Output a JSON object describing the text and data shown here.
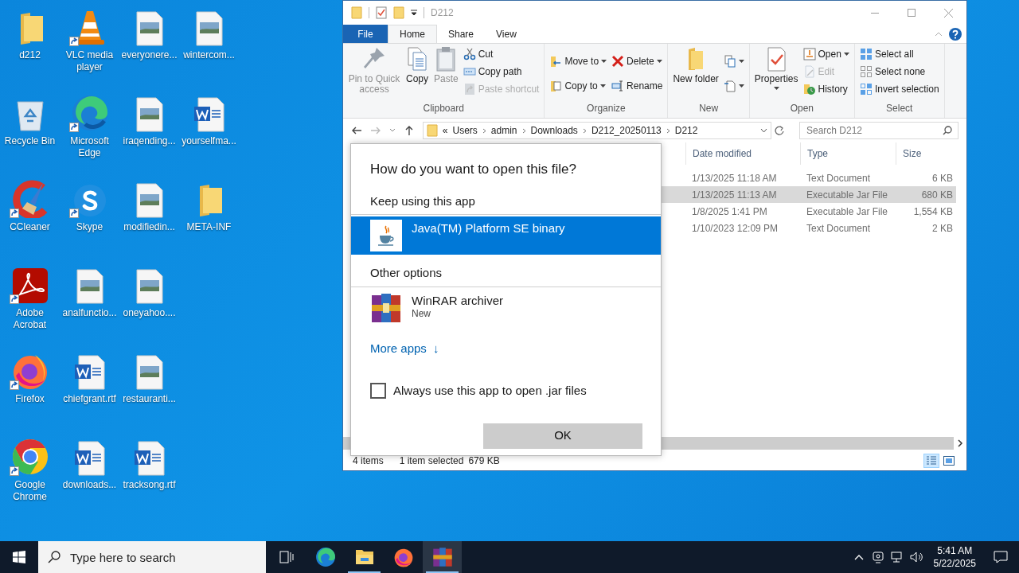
{
  "desktop": {
    "icons": [
      {
        "label": "d212",
        "kind": "folder",
        "shortcut": false
      },
      {
        "label": "Recycle Bin",
        "kind": "recycle",
        "shortcut": false
      },
      {
        "label": "CCleaner",
        "kind": "ccleaner",
        "shortcut": true
      },
      {
        "label": "Adobe Acrobat",
        "kind": "acrobat",
        "shortcut": true
      },
      {
        "label": "Firefox",
        "kind": "firefox",
        "shortcut": true
      },
      {
        "label": "Google Chrome",
        "kind": "chrome",
        "shortcut": true
      },
      {
        "label": "VLC media player",
        "kind": "vlc",
        "shortcut": true
      },
      {
        "label": "Microsoft Edge",
        "kind": "edge",
        "shortcut": true
      },
      {
        "label": "Skype",
        "kind": "skype",
        "shortcut": true
      },
      {
        "label": "analfunctio...",
        "kind": "image",
        "shortcut": false
      },
      {
        "label": "chiefgrant.rtf",
        "kind": "word",
        "shortcut": false
      },
      {
        "label": "downloads...",
        "kind": "word",
        "shortcut": false
      },
      {
        "label": "everyonere...",
        "kind": "image",
        "shortcut": false
      },
      {
        "label": "iraqending...",
        "kind": "image",
        "shortcut": false
      },
      {
        "label": "modifiedin...",
        "kind": "image",
        "shortcut": false
      },
      {
        "label": "oneyahoo....",
        "kind": "image",
        "shortcut": false
      },
      {
        "label": "restauranti...",
        "kind": "image",
        "shortcut": false
      },
      {
        "label": "tracksong.rtf",
        "kind": "word",
        "shortcut": false
      },
      {
        "label": "wintercom...",
        "kind": "image",
        "shortcut": false
      },
      {
        "label": "yourselfma...",
        "kind": "word",
        "shortcut": false
      },
      {
        "label": "META-INF",
        "kind": "folder",
        "shortcut": false
      }
    ]
  },
  "explorer": {
    "title": "D212",
    "file_tab": "File",
    "tabs": [
      {
        "label": "Home",
        "selected": true
      },
      {
        "label": "Share",
        "selected": false
      },
      {
        "label": "View",
        "selected": false
      }
    ],
    "ribbon": [
      {
        "label": "Clipboard",
        "columns": [
          {
            "kind": "large",
            "label": "Pin to Quick access",
            "disabled": true,
            "dropdown": false
          },
          {
            "kind": "large",
            "label": "Copy",
            "disabled": false,
            "dropdown": false
          },
          {
            "kind": "large",
            "label": "Paste",
            "disabled": true,
            "dropdown": false
          },
          {
            "kind": "stack",
            "items": [
              {
                "label": "Cut",
                "disabled": false,
                "dropdown": false
              },
              {
                "label": "Copy path",
                "disabled": false,
                "dropdown": false
              },
              {
                "label": "Paste shortcut",
                "disabled": true,
                "dropdown": false
              }
            ]
          }
        ]
      },
      {
        "label": "Organize",
        "columns": [
          {
            "kind": "stack",
            "items": [
              {
                "label": "Move to",
                "disabled": false,
                "dropdown": true
              },
              {
                "label": "Copy to",
                "disabled": false,
                "dropdown": true
              }
            ]
          },
          {
            "kind": "stack",
            "items": [
              {
                "label": "Delete",
                "disabled": false,
                "dropdown": true
              },
              {
                "label": "Rename",
                "disabled": false,
                "dropdown": false
              }
            ]
          }
        ]
      },
      {
        "label": "New",
        "columns": [
          {
            "kind": "large",
            "label": "New folder",
            "disabled": false,
            "dropdown": false
          },
          {
            "kind": "stack",
            "items": [
              {
                "disabled": false,
                "dropdown": true
              },
              {
                "disabled": false,
                "dropdown": true
              }
            ]
          }
        ]
      },
      {
        "label": "Open",
        "columns": [
          {
            "kind": "large",
            "label": "Properties",
            "disabled": false,
            "dropdown": true
          },
          {
            "kind": "stack",
            "items": [
              {
                "label": "Open",
                "disabled": false,
                "dropdown": true
              },
              {
                "label": "Edit",
                "disabled": true,
                "dropdown": false
              },
              {
                "label": "History",
                "disabled": false,
                "dropdown": false
              }
            ]
          }
        ]
      },
      {
        "label": "Select",
        "columns": [
          {
            "kind": "stack",
            "items": [
              {
                "label": "Select all",
                "disabled": false,
                "dropdown": false
              },
              {
                "label": "Select none",
                "disabled": false,
                "dropdown": false
              },
              {
                "label": "Invert selection",
                "disabled": false,
                "dropdown": false
              }
            ]
          }
        ]
      }
    ],
    "address": {
      "overflow": "«",
      "crumbs": [
        "Users",
        "admin",
        "Downloads",
        "D212_20250113",
        "D212"
      ]
    },
    "search": {
      "placeholder": "Search D212"
    },
    "columns": [
      "Date modified",
      "Type",
      "Size"
    ],
    "rows": [
      {
        "date": "1/13/2025 11:18 AM",
        "type": "Text Document",
        "size": "6 KB",
        "selected": false
      },
      {
        "date": "1/13/2025 11:13 AM",
        "type": "Executable Jar File",
        "size": "680 KB",
        "selected": true
      },
      {
        "date": "1/8/2025 1:41 PM",
        "type": "Executable Jar File",
        "size": "1,554 KB",
        "selected": false
      },
      {
        "date": "1/10/2023 12:09 PM",
        "type": "Text Document",
        "size": "2 KB",
        "selected": false
      }
    ],
    "status": {
      "count": "4 items",
      "selection": "1 item selected",
      "selection_size": "679 KB"
    },
    "views": [
      {
        "kind": "details",
        "selected": true
      },
      {
        "kind": "large_icons",
        "selected": false
      }
    ]
  },
  "dialog": {
    "title": "How do you want to open this file?",
    "sections": [
      {
        "heading": "Keep using this app",
        "apps": [
          {
            "name": "Java(TM) Platform SE binary",
            "kind": "java",
            "selected": true
          }
        ]
      },
      {
        "heading": "Other options",
        "apps": [
          {
            "name": "WinRAR archiver",
            "subtitle": "New",
            "kind": "winrar",
            "selected": false
          }
        ]
      }
    ],
    "more_link": "More apps",
    "more_arrow": "↓",
    "checkbox": {
      "label": "Always use this app to open .jar files",
      "checked": false
    },
    "button": "OK"
  },
  "taskbar": {
    "search_placeholder": "Type here to search",
    "apps": [
      {
        "kind": "taskview",
        "running": false,
        "selected": false
      },
      {
        "kind": "edge",
        "running": false,
        "selected": false
      },
      {
        "kind": "explorer",
        "running": true,
        "selected": false
      },
      {
        "kind": "firefox",
        "running": false,
        "selected": false
      },
      {
        "kind": "winrar",
        "running": true,
        "selected": true
      }
    ],
    "time": "5:41 AM",
    "date": "5/22/2025"
  }
}
